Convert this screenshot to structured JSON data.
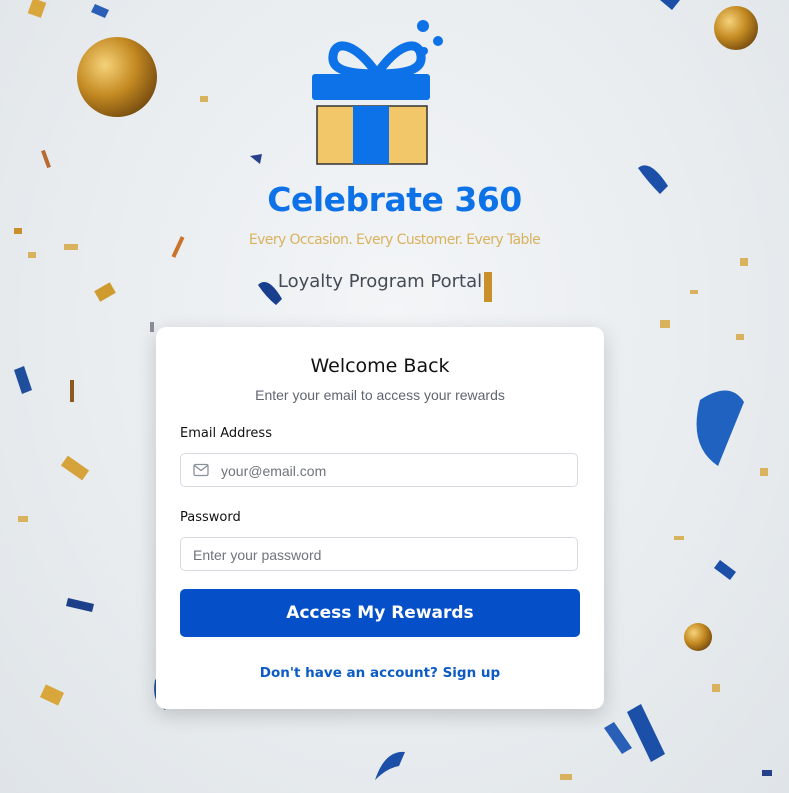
{
  "brand": {
    "title": "Celebrate 360",
    "tagline": "Every Occasion. Every Customer. Every Table",
    "subtitle": "Loyalty Program Portal",
    "logo_icon": "gift-box-icon"
  },
  "colors": {
    "brand_blue": "#0d72e8",
    "tagline_gold": "#d9b25e",
    "button_blue": "#0550c8",
    "link_blue": "#0d5bc4"
  },
  "login_card": {
    "title": "Welcome Back",
    "subtitle": "Enter your email to access your rewards",
    "email": {
      "label": "Email Address",
      "placeholder": "your@email.com",
      "value": "",
      "icon": "mail-icon"
    },
    "password": {
      "label": "Password",
      "placeholder": "Enter your password",
      "value": ""
    },
    "submit_label": "Access My Rewards",
    "signup_prompt": "Don't have an account?",
    "signup_link": "Sign up"
  }
}
